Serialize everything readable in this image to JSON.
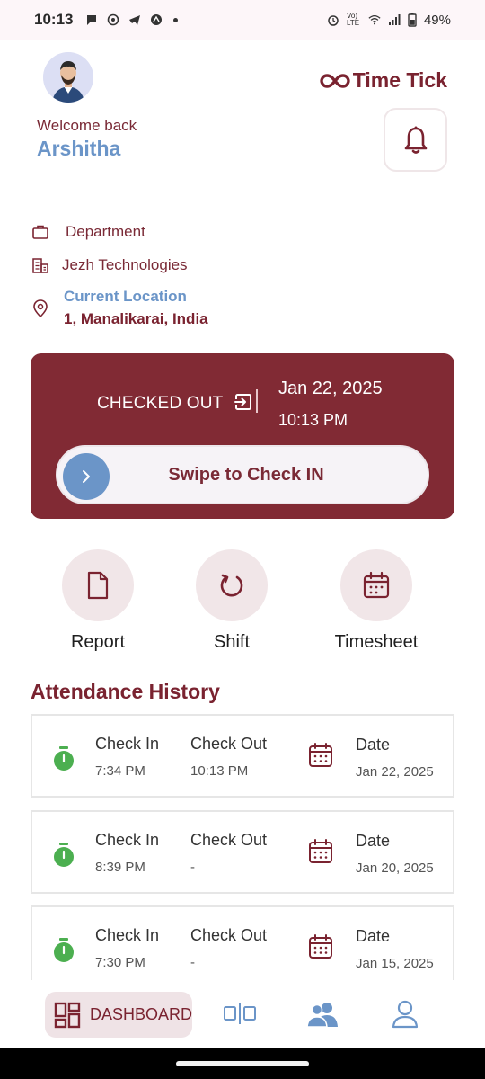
{
  "status_bar": {
    "time": "10:13",
    "network_label": "Vo) LTE",
    "battery": "49%"
  },
  "header": {
    "brand": "Time Tick",
    "welcome": "Welcome back",
    "username": "Arshitha"
  },
  "info": {
    "department": "Department",
    "company": "Jezh Technologies",
    "location_title": "Current Location",
    "location_value": "1, Manalikarai, India"
  },
  "check_card": {
    "status": "CHECKED OUT",
    "date": "Jan 22, 2025",
    "time": "10:13 PM",
    "swipe_label": "Swipe to Check IN"
  },
  "actions": [
    {
      "label": "Report"
    },
    {
      "label": "Shift"
    },
    {
      "label": "Timesheet"
    }
  ],
  "attendance": {
    "title": "Attendance History",
    "labels": {
      "check_in": "Check In",
      "check_out": "Check Out",
      "date": "Date"
    },
    "records": [
      {
        "check_in": "7:34 PM",
        "check_out": "10:13 PM",
        "date": "Jan 22, 2025"
      },
      {
        "check_in": "8:39 PM",
        "check_out": "-",
        "date": "Jan 20, 2025"
      },
      {
        "check_in": "7:30 PM",
        "check_out": "-",
        "date": "Jan 15, 2025"
      }
    ]
  },
  "bottom_nav": {
    "dashboard": "DASHBOARD"
  },
  "colors": {
    "brand": "#812a34",
    "accent_blue": "#6b95c8",
    "stopwatch_green": "#4caf50"
  }
}
